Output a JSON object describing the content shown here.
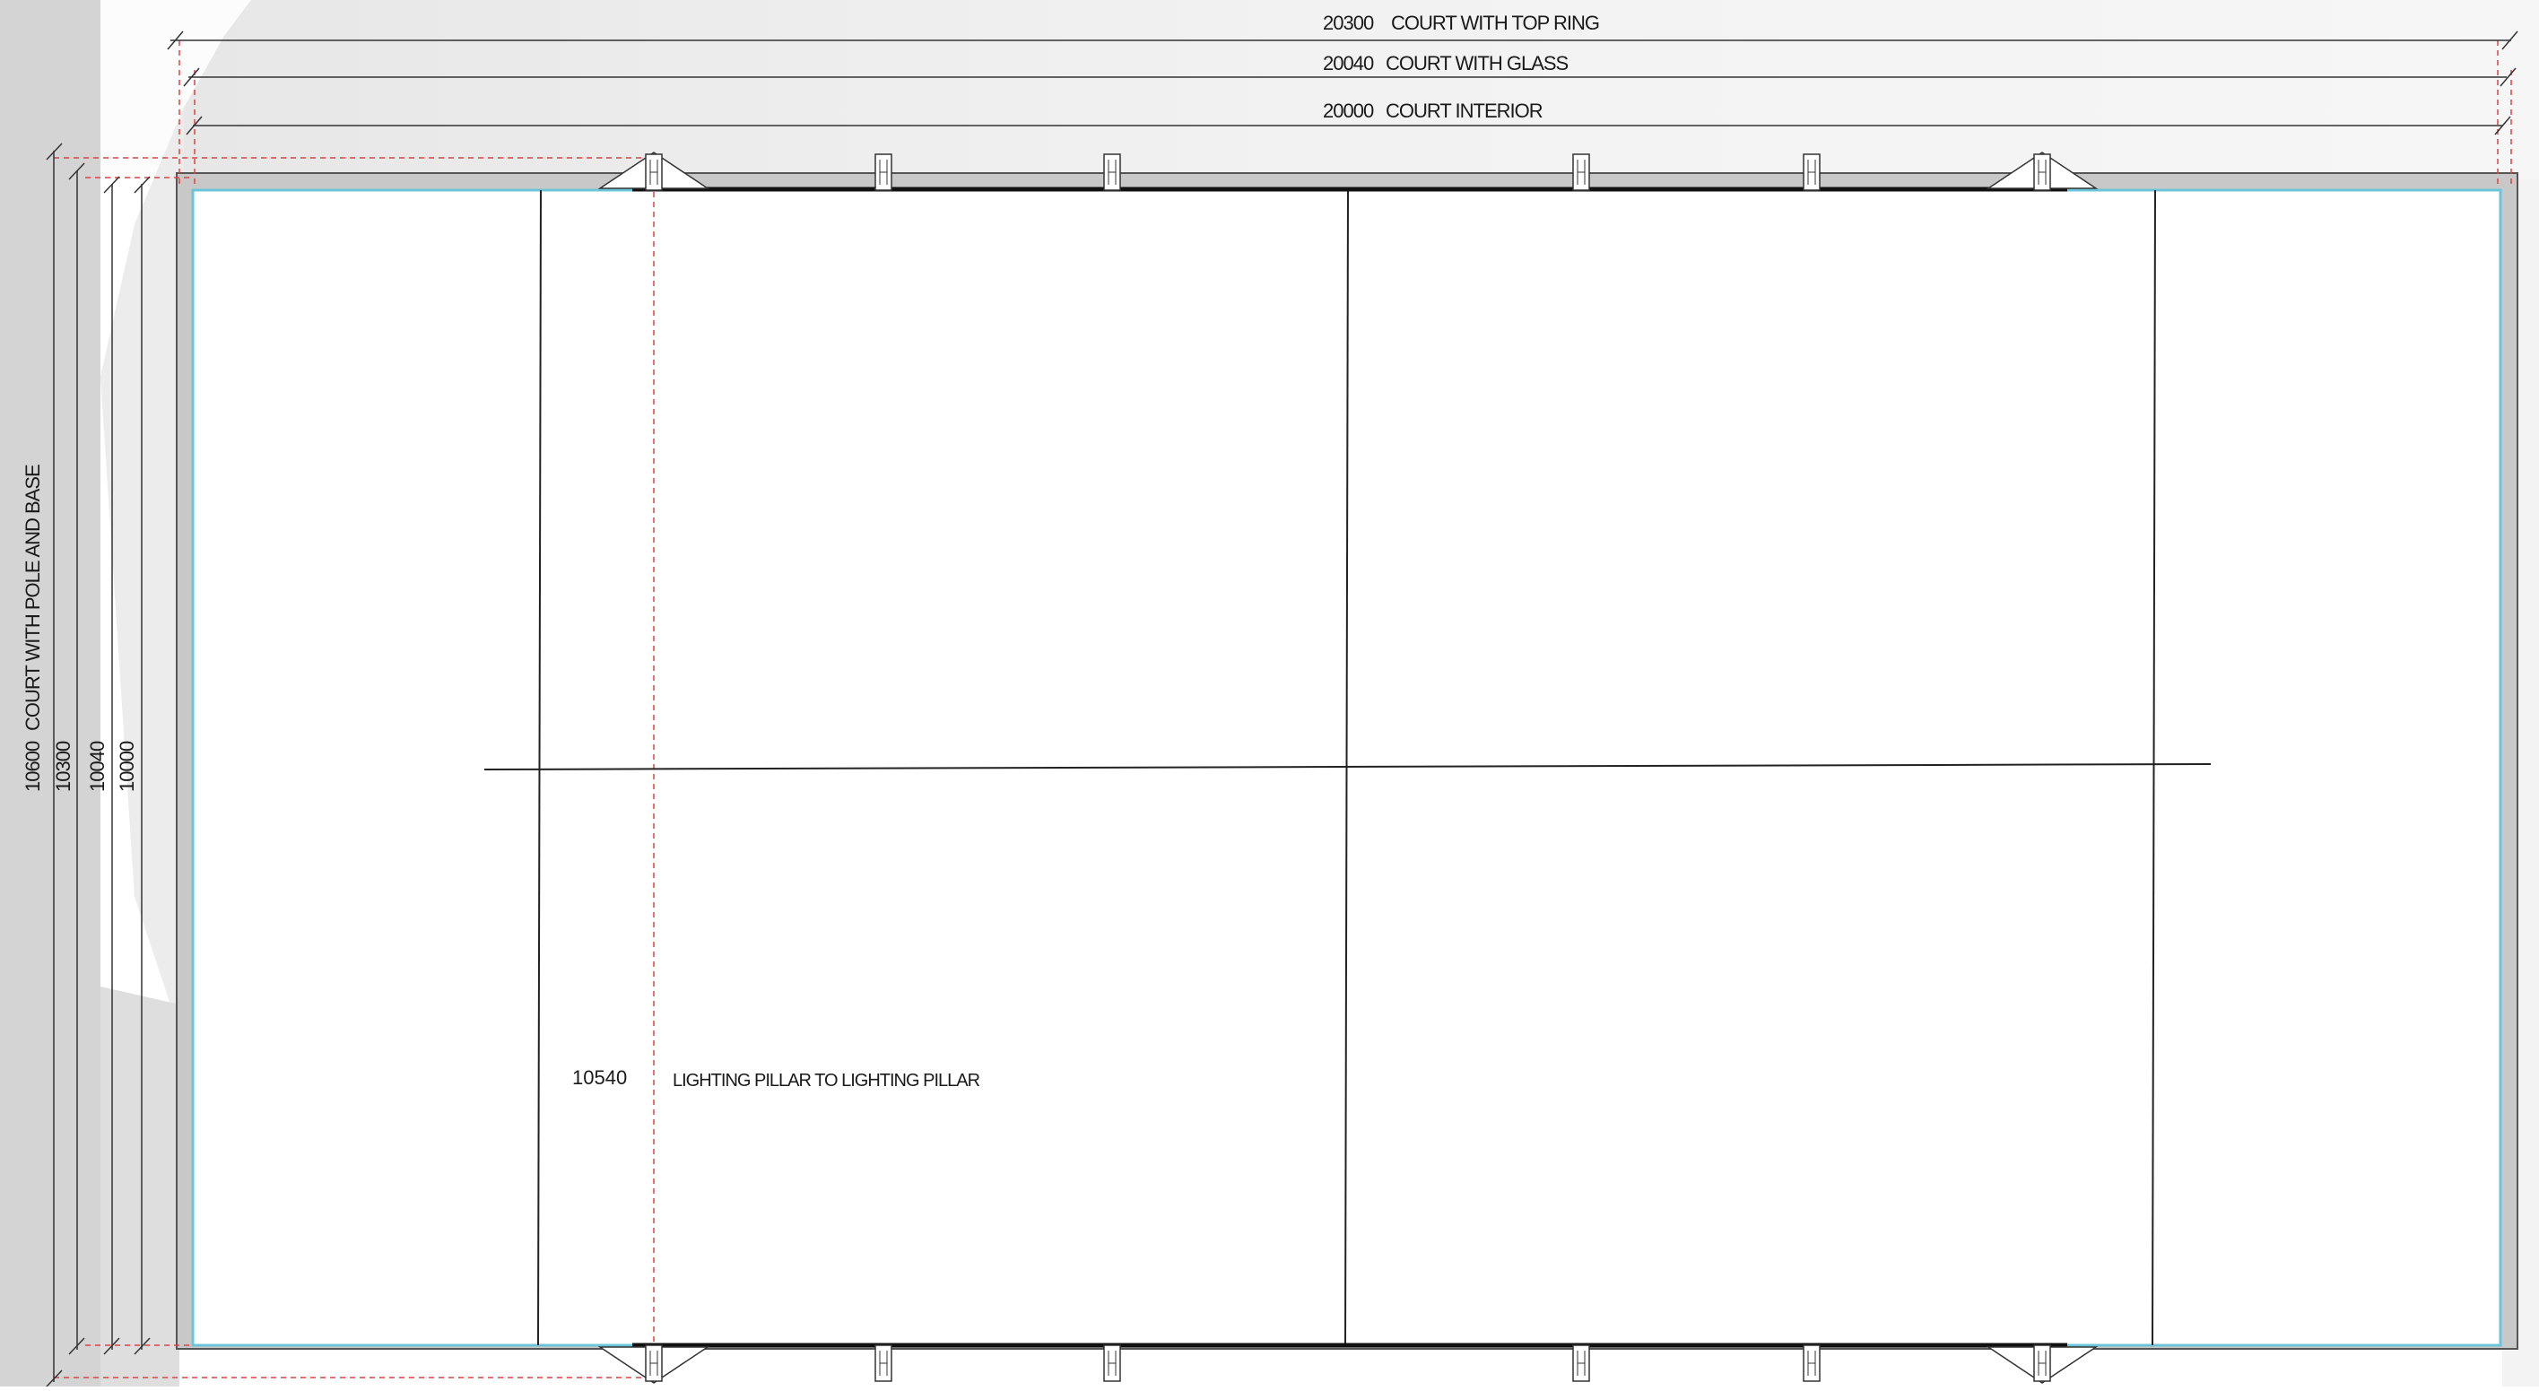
{
  "drawing": {
    "horizontal_dimensions": [
      {
        "value": "20300",
        "label": "COURT WITH TOP RING"
      },
      {
        "value": "20040",
        "label": "COURT WITH GLASS"
      },
      {
        "value": "20000",
        "label": "COURT INTERIOR"
      }
    ],
    "vertical_dimensions": [
      {
        "value": "10600",
        "label": "COURT WITH POLE AND BASE"
      },
      {
        "value": "10300"
      },
      {
        "value": "10040"
      },
      {
        "value": "10000"
      }
    ],
    "pillar_dimension": {
      "value": "10540",
      "label": "LIGHTING PILLAR  TO LIGHTING PILLAR"
    }
  }
}
